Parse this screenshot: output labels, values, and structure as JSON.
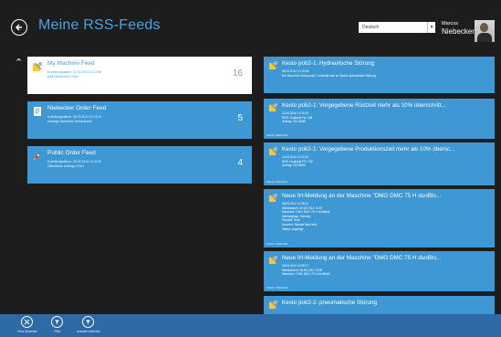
{
  "header": {
    "title": "Meine RSS-Feeds",
    "language": "Deutsch",
    "user_first": "Marcus",
    "user_last": "Niebecker"
  },
  "feeds": [
    {
      "title": "My Machine Feed",
      "line1": "Erstellungsdatum: 21.03.2014 12:12:06",
      "line2": "Mein Maschinen Feed",
      "count": "16",
      "icon": "rss-feed-icon",
      "selected": true
    },
    {
      "title": "Niebecker Order Feed",
      "line1": "Erstellungsdatum: 06.03.2014 12:21:04",
      "line2": "Aufträge Niebecker Seibersbach",
      "count": "5",
      "icon": "document-icon",
      "selected": false
    },
    {
      "title": "Public Order Feed",
      "line1": "Erstellungsdatum: 28.04.2014 15:41:31",
      "line2": "Öffentlicher Auftrags-Feed",
      "count": "4",
      "icon": "rocket-icon",
      "selected": false
    }
  ],
  "messages": [
    {
      "title": "Kesto pob2-1: Hydraulische Störung",
      "lines": [
        "06.05.2014 12:15:08",
        "Die Maschine Kesto pob2-1 befindet sich im Status hydraulische Störung"
      ],
      "foot": ""
    },
    {
      "title": "Kesto pob2-1: Vorgegebene Rüstzeit mehr als 10% überschritt...",
      "lines": [
        "10.05.2014 12:15:20",
        "NRS: Geplante Rz: 168",
        "Auftrag: 11176088"
      ],
      "foot": "MEHR ANZEIGEN"
    },
    {
      "title": "Kesto pob2-1: Vorgegebene Produktionszeit mehr als 10% übersc...",
      "lines": [
        "16.05.2014 12:15:40",
        "NRS: Geplante PZ: 768",
        "Auftrag: 11176090"
      ],
      "foot": "MEHR ANZEIGEN"
    },
    {
      "title": "Neue IH-Meldung an der Maschine \"DMG DMC 75 H duoBlo...",
      "lines": [
        "08.05.2014 11:08:01",
        "Meldedatum: 08.05.2014 11:08",
        "Maschine: DMG DMC 75 H duoBlock",
        "Meldungstyp: Störung",
        "Priorität: Hoch",
        "Kurztext: Spindel läuft heiß",
        "Status: Angelegt"
      ],
      "foot": "MEHR ANZEIGEN"
    },
    {
      "title": "Neue IH-Meldung an der Maschine \"DMG DMC 75 H duoBlo...",
      "lines": [
        "08.05.2014 10:55:17",
        "Meldedatum: 08.05.2014 10:55",
        "Maschine: DMG DMC 75 H duoBlock"
      ],
      "foot": "MEHR ANZEIGEN"
    },
    {
      "title": "Kesto pob2-2: pneumatische Störung",
      "lines": [],
      "foot": ""
    }
  ],
  "appbar": [
    {
      "label": "Feed Abmelden",
      "icon": "close-icon"
    },
    {
      "label": "Filter",
      "icon": "filter-icon"
    },
    {
      "label": "Auswahl aufheben",
      "icon": "filter-icon"
    }
  ],
  "colors": {
    "background": "#1d1d1d",
    "accent": "#3d98d4",
    "title": "#4aa3df",
    "appbar": "#2e6aa8"
  }
}
